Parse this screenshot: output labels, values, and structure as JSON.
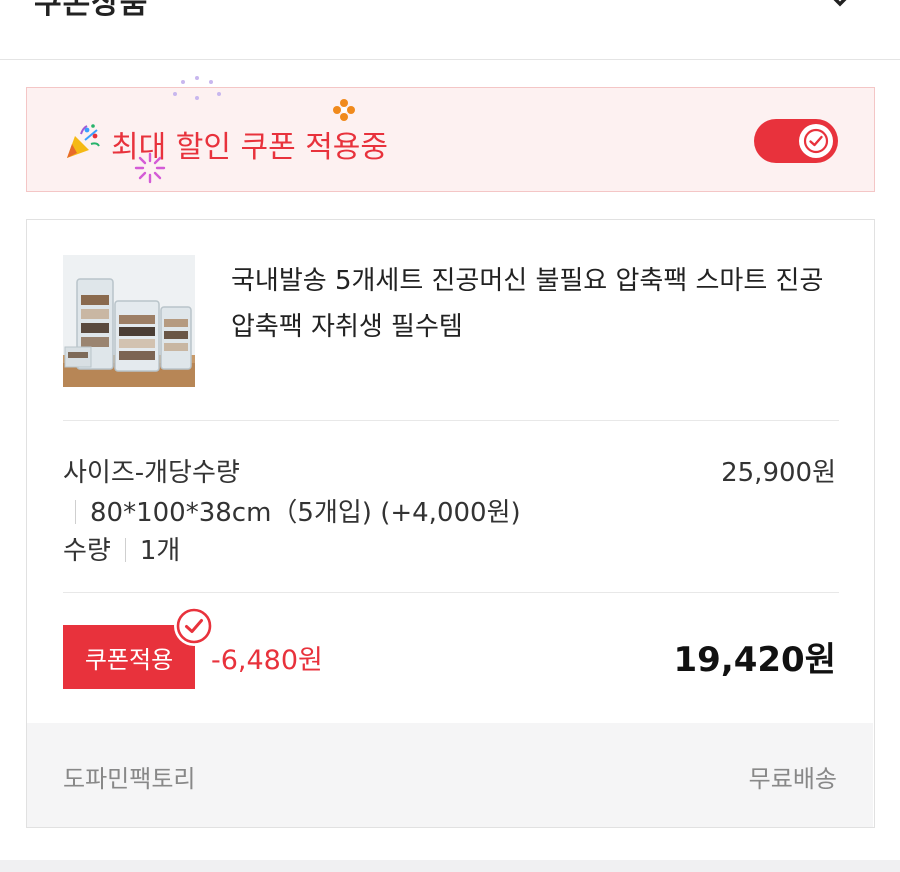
{
  "header": {
    "title": "쿠폰상품"
  },
  "banner": {
    "text": "최대 할인 쿠폰 적용중",
    "toggle_on": true
  },
  "product": {
    "name": "국내발송 5개세트 진공머신 불필요 압축팩 스마트 진공 압축팩 자취생 필수템",
    "option_label": "사이즈-개당수량",
    "option_value": "80*100*38cm（5개입) (+4,000원)",
    "quantity_label": "수량",
    "quantity_value": "1개",
    "option_price": "25,900원"
  },
  "coupon": {
    "button_label": "쿠폰적용",
    "discount": "-6,480원",
    "final_price": "19,420원"
  },
  "footer": {
    "seller": "도파민팩토리",
    "shipping": "무료배송"
  },
  "colors": {
    "accent": "#e8323c",
    "banner_bg": "#fdf1f1",
    "footer_bg": "#f5f5f6"
  }
}
